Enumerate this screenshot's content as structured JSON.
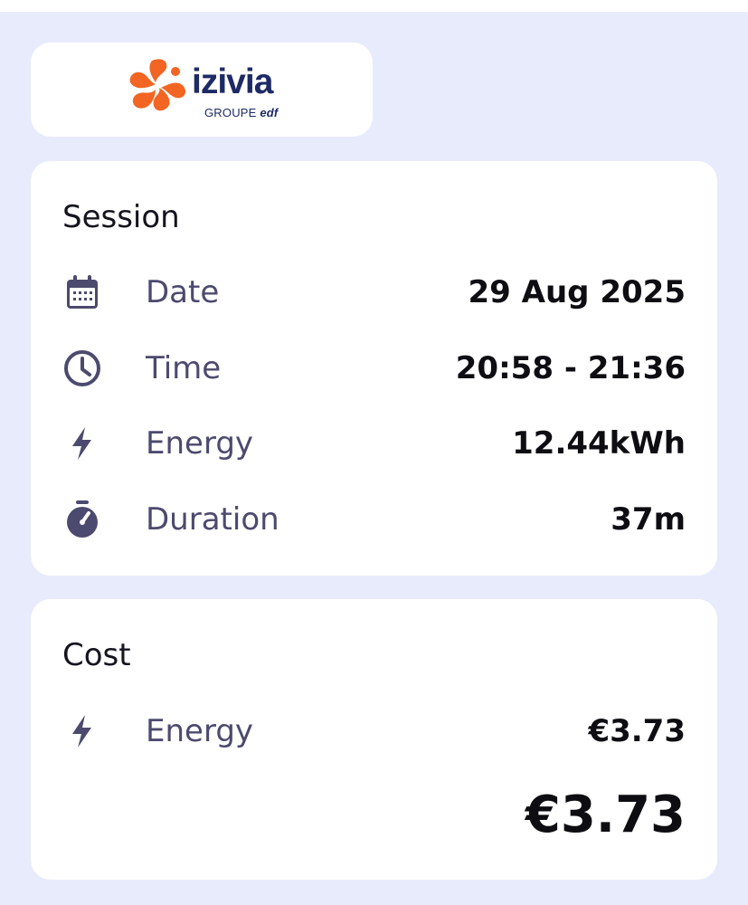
{
  "brand": {
    "name": "izivia",
    "group_prefix": "GROUPE",
    "group_name": "edf",
    "primary_color": "#1e2a66",
    "accent_color": "#f26522"
  },
  "session": {
    "title": "Session",
    "rows": [
      {
        "icon": "calendar-icon",
        "label": "Date",
        "value": "29 Aug 2025"
      },
      {
        "icon": "clock-icon",
        "label": "Time",
        "value": "20:58 - 21:36"
      },
      {
        "icon": "lightning-icon",
        "label": "Energy",
        "value": "12.44kWh"
      },
      {
        "icon": "stopwatch-icon",
        "label": "Duration",
        "value": "37m"
      }
    ]
  },
  "cost": {
    "title": "Cost",
    "rows": [
      {
        "icon": "lightning-icon",
        "label": "Energy",
        "value": "€3.73"
      }
    ],
    "total": "€3.73"
  },
  "colors": {
    "background": "#e8ebfc",
    "card": "#ffffff",
    "label": "#4c4a6e",
    "icon": "#4c4a6e",
    "value": "#0d0d12"
  }
}
